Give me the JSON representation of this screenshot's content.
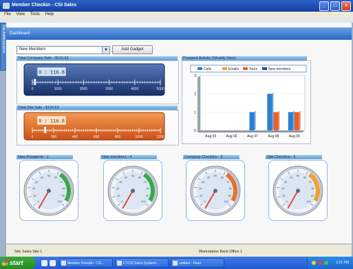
{
  "window": {
    "title": "Member Checkin - CSI Sales"
  },
  "menu": [
    "File",
    "View",
    "Tools",
    "Help"
  ],
  "side_tab": {
    "label": "Site Administration"
  },
  "dashboard": {
    "title": "Dashboard"
  },
  "toolbar": {
    "select_value": "New Members",
    "add_button": "Add Gadget"
  },
  "company_sales": {
    "title": "Total Company Sale - $116.63",
    "readout": "0 : 116.8",
    "ticks": [
      "0",
      "1000",
      "2000",
      "3000",
      "4000",
      "5000"
    ],
    "level": 0.02,
    "color": "#1e3a7a"
  },
  "site_sales": {
    "title": "Total Site Sale - $116.63",
    "readout": "0 : 116.8",
    "ticks": [
      "0",
      "200",
      "400",
      "600",
      "800",
      "1000",
      "1200"
    ],
    "level": 0.1,
    "color": "#e0641e"
  },
  "prospect_activity": {
    "title": "Prospect Activity (Weekly View)",
    "chart_data": {
      "type": "bar",
      "title": "",
      "categories": [
        "Aug 03",
        "Aug 06",
        "Aug 07",
        "Aug 08",
        "Aug 09"
      ],
      "series": [
        {
          "name": "Calls",
          "color": "#2a7fd4",
          "values": [
            0,
            0,
            1,
            2,
            1
          ]
        },
        {
          "name": "Emails",
          "color": "#f0a030",
          "values": [
            0,
            0,
            0,
            0,
            0
          ]
        },
        {
          "name": "Tours",
          "color": "#e8602a",
          "values": [
            0,
            0,
            0,
            1,
            1
          ]
        },
        {
          "name": "New members",
          "color": "#1a4ea0",
          "values": [
            0,
            0,
            0,
            0,
            0
          ]
        }
      ],
      "yticks": [
        "0",
        "1",
        "2",
        "3"
      ],
      "ylim": [
        0,
        3
      ],
      "legend": "top"
    }
  },
  "gauges": [
    {
      "title": "New Prospects - 1",
      "arc": "#3aa84a"
    },
    {
      "title": "New members - 4",
      "arc": "#3aa84a"
    },
    {
      "title": "Company Checkins - 5",
      "arc": "#e8702a"
    },
    {
      "title": "Site Checkins - 5",
      "arc": "#f0a030"
    }
  ],
  "dial_labels": [
    "0",
    "10",
    "20",
    "30",
    "40",
    "50",
    "60",
    "70",
    "80",
    "90",
    "100"
  ],
  "status": {
    "left": "Site Sales Site 1",
    "right": "Workstation Back Office 1"
  },
  "taskbar": {
    "start": "start",
    "tasks": [
      "Member Checkin - CS...",
      "C:\\CSI Sales System\\...",
      "untitled - Paint"
    ],
    "clock": "1:21 PM"
  }
}
